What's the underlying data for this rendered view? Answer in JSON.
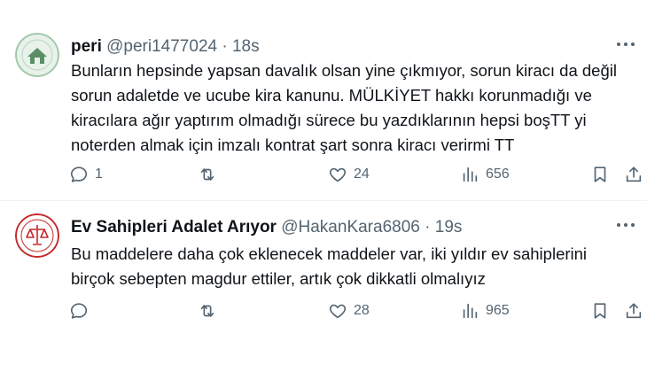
{
  "tweets": [
    {
      "name": "peri",
      "handle": "@peri1477024",
      "separator": "·",
      "time": "18s",
      "text": "Bunların hepsinde yapsan davalık olsan yine çıkmıyor, sorun kiracı da değil sorun adaletde ve ucube kira kanunu. MÜLKİYET hakkı korunmadığı ve kiracılara ağır yaptırım olmadığı sürece bu yazdıklarının hepsi boşTT yi noterden almak için imzalı kontrat şart sonra kiracı verirmi TT",
      "replies": "1",
      "retweets": "",
      "likes": "24",
      "views": "656",
      "avatar_colors": {
        "ring": "#9fc7a9",
        "fill": "#e8f1ea",
        "house": "#5a8f66"
      }
    },
    {
      "name": "Ev Sahipleri Adalet Arıyor",
      "handle": "@HakanKara6806",
      "separator": "·",
      "time": "19s",
      "text": "Bu maddelere daha çok eklenecek maddeler var, iki yıldır ev sahiplerini birçok sebepten magdur ettiler, artık çok dikkatli olmalıyız",
      "replies": "",
      "retweets": "",
      "likes": "28",
      "views": "965",
      "avatar_colors": {
        "ring": "#c62828",
        "fill": "#ffffff",
        "scale": "#c62828"
      }
    }
  ],
  "colors": {
    "text": "#0f1419",
    "muted": "#536471",
    "divider": "#eff3f4"
  },
  "icons": [
    "reply-icon",
    "retweet-icon",
    "like-icon",
    "views-icon",
    "bookmark-icon",
    "share-icon",
    "more-icon"
  ]
}
